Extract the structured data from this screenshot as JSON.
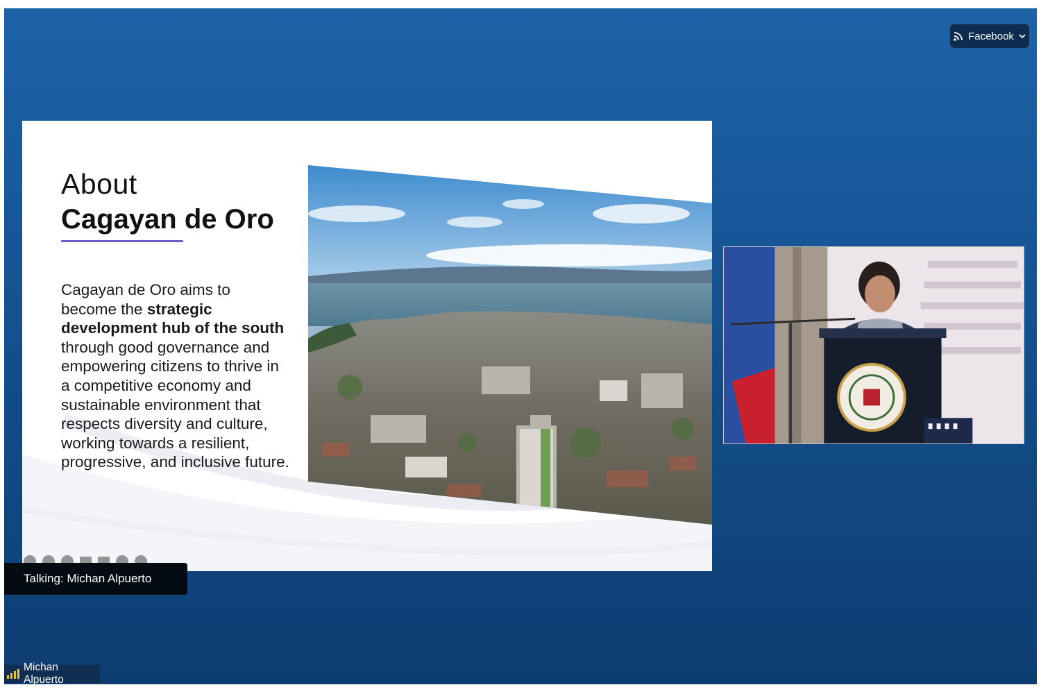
{
  "stream": {
    "platform_label": "Facebook",
    "icon": "broadcast-icon",
    "dropdown_icon": "chevron-down-icon"
  },
  "slide": {
    "heading_line1": "About",
    "heading_line2": "Cagayan de Oro",
    "body_part1": "Cagayan de Oro aims to become the ",
    "body_bold": "strategic development hub of the south",
    "body_part2": " through good governance and empowering citizens to thrive in a competitive economy and sustainable environment that respects diversity and culture, working towards a resilient, progressive, and inclusive future.",
    "accent_color": "#6a5fc7"
  },
  "talking": {
    "label": "Talking: Michan Alpuerto"
  },
  "participant": {
    "name": "Michan Alpuerto",
    "signal_color": "#f2c230"
  }
}
